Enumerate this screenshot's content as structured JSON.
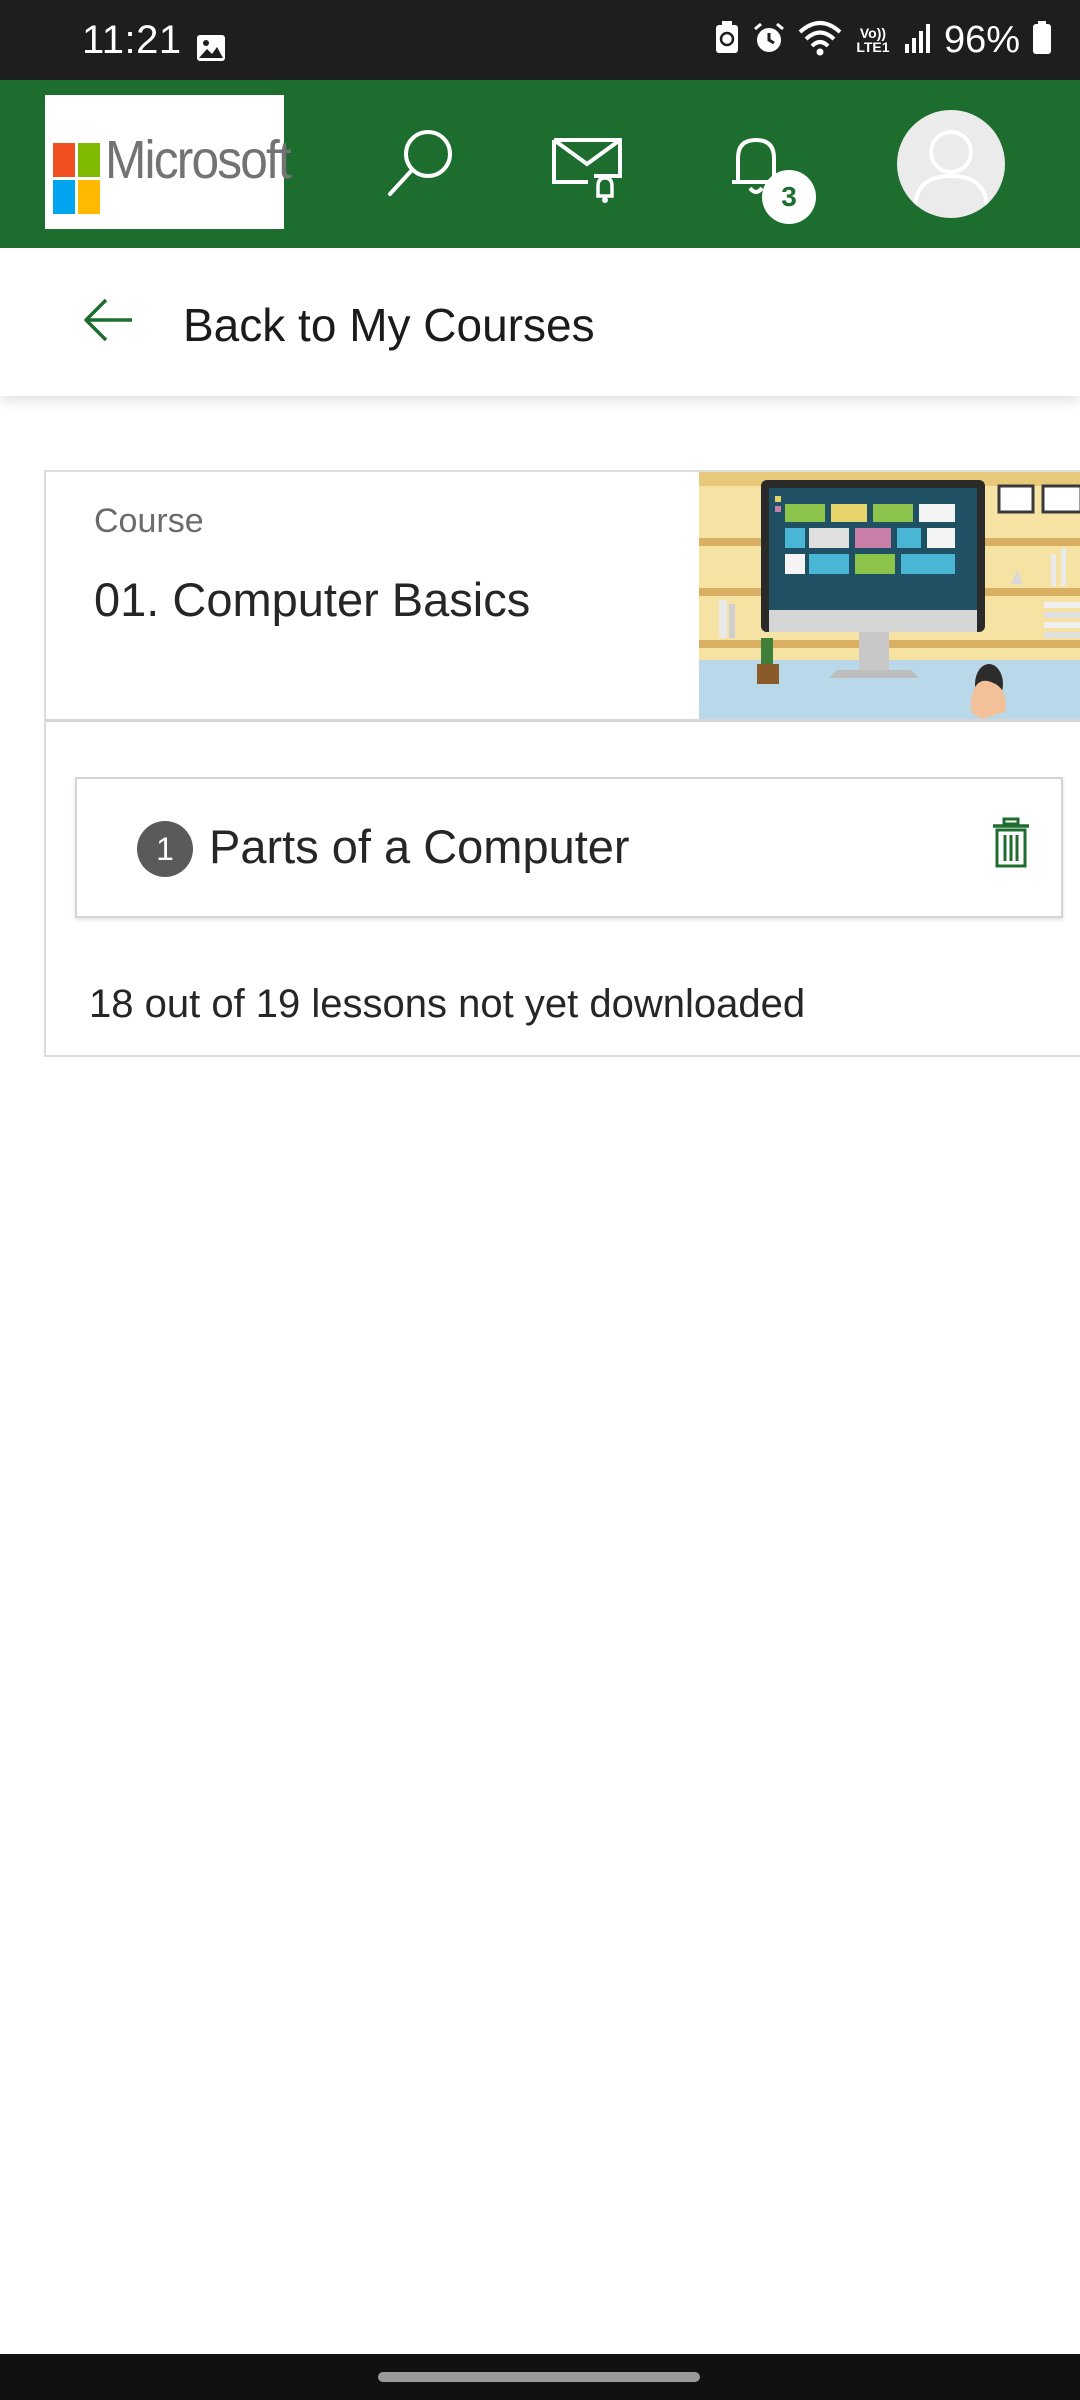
{
  "status_bar": {
    "time": "11:21",
    "network_label": "Vo)) LTE1",
    "battery": "96%",
    "icons": [
      "gallery-icon",
      "recycle-icon",
      "alarm-icon",
      "wifi-icon",
      "signal-icon",
      "battery-icon"
    ]
  },
  "header": {
    "logo_text": "Microsoft",
    "notification_count": "3",
    "background_color": "#1d6d2f",
    "icons": [
      "search-icon",
      "mail-notification-icon",
      "bell-icon",
      "avatar-icon"
    ]
  },
  "nav": {
    "back_label": "Back to My Courses"
  },
  "course": {
    "kicker": "Course",
    "title": "01. Computer Basics",
    "lessons": [
      {
        "number": "1",
        "title": "Parts of a Computer"
      }
    ],
    "download_status": "18 out of 19 lessons not yet downloaded"
  }
}
